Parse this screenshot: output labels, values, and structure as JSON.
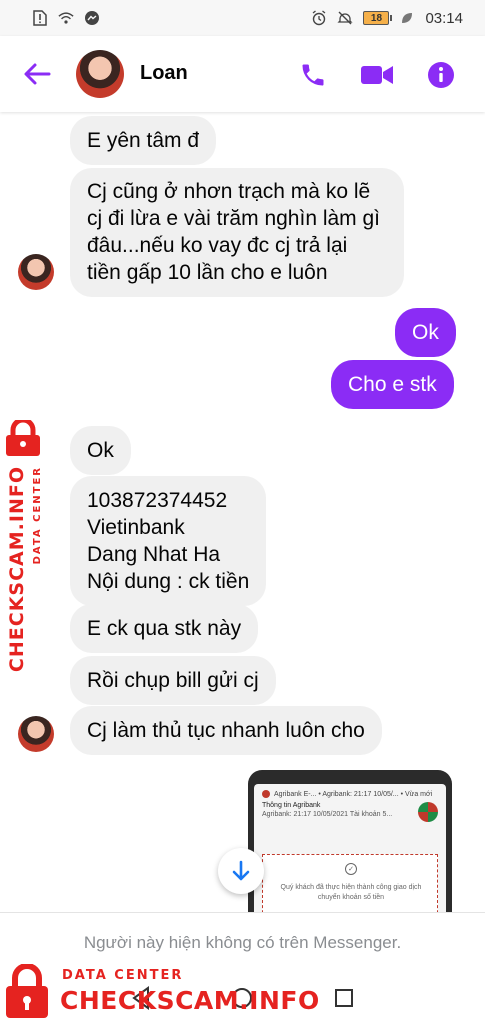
{
  "status_bar": {
    "time": "03:14",
    "battery": "18"
  },
  "header": {
    "contact_name": "Loan"
  },
  "colors": {
    "accent": "#8b2cf5",
    "incoming_bubble": "#f0f0f0",
    "watermark": "#e52320"
  },
  "messages": [
    {
      "from": "contact",
      "text": "E yên tâm đ"
    },
    {
      "from": "contact",
      "text": "Cj cũng ở nhơn trạch mà ko lẽ\ncj đi lừa e vài trăm nghìn làm gì\nđâu...nếu ko vay đc cj trả lại\ntiền gấp 10 lần cho e luôn"
    },
    {
      "from": "me",
      "text": "Ok"
    },
    {
      "from": "me",
      "text": "Cho e stk"
    },
    {
      "from": "contact",
      "text": "Ok"
    },
    {
      "from": "contact",
      "text": "103872374452\nVietinbank\nDang Nhat Ha\nNội dung : ck tiền"
    },
    {
      "from": "contact",
      "text": "E ck qua stk này"
    },
    {
      "from": "contact",
      "text": "Rồi chụp bill gửi cj"
    },
    {
      "from": "contact",
      "text": "Cj làm thủ tục nhanh luôn cho"
    }
  ],
  "receipt": {
    "top_line": "Agribank E-... • Agribank: 21:17 10/05/... • Vừa mới",
    "title": "Thông tin Agribank",
    "subtitle": "Agribank: 21:17 10/05/2021 Tài khoản 5...",
    "card_text": "Quý khách đã thực hiện thành công giao dịch chuyển khoản số tiền"
  },
  "footer": {
    "unavailable_text": "Người này hiện không có trên Messenger."
  },
  "watermark": {
    "sub": "DATA CENTER",
    "main": "CHECKSCAM.INFO"
  }
}
